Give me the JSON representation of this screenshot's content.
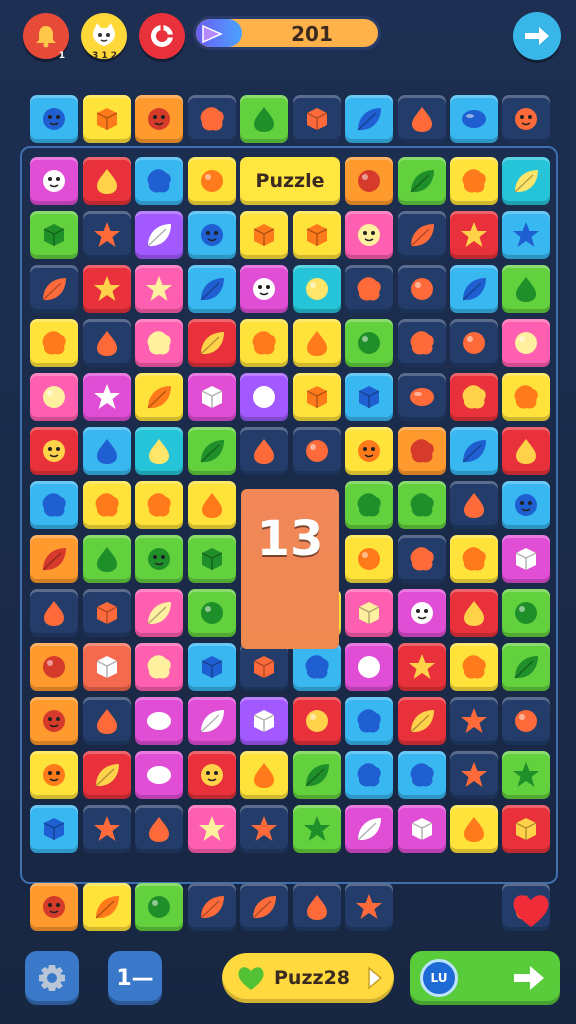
{
  "top_bar": {
    "progress_value": "201",
    "progress_fraction": 0.25,
    "bell_badge": "1",
    "cat_badge": "3 1 2",
    "buttons": [
      "bell-icon",
      "cat-face-icon",
      "lifesaver-icon",
      "arrow-right-icon"
    ]
  },
  "board": {
    "puzzle_label": "Puzzle",
    "big_number": "13"
  },
  "bottom_bar": {
    "left_icon": "gear-icon",
    "menu_label": "1—",
    "puzzle_button_label": "Puzz28",
    "go_coin_label": "LU"
  },
  "palette": {
    "yellow": "#ffe23a",
    "red": "#e8313a",
    "blue": "#39b7f0",
    "orange": "#ff9a2e",
    "green": "#63d13e",
    "pink": "#ff5fb0",
    "purple": "#a259ff",
    "teal": "#25c4d8",
    "magenta": "#e14ed6",
    "navy": "#233c6a",
    "salmon": "#f46a4e"
  },
  "tiles": [
    {
      "row": 0,
      "col": 0,
      "c": "blue",
      "s": "face"
    },
    {
      "row": 0,
      "col": 1,
      "c": "yellow",
      "s": "box"
    },
    {
      "row": 0,
      "col": 2,
      "c": "orange",
      "s": "face"
    },
    {
      "row": 0,
      "col": 3,
      "c": "navy",
      "s": "blob"
    },
    {
      "row": 0,
      "col": 4,
      "c": "green",
      "s": "drop"
    },
    {
      "row": 0,
      "col": 5,
      "c": "navy",
      "s": "box"
    },
    {
      "row": 0,
      "col": 6,
      "c": "blue",
      "s": "leaf"
    },
    {
      "row": 0,
      "col": 7,
      "c": "navy",
      "s": "drop"
    },
    {
      "row": 0,
      "col": 8,
      "c": "blue",
      "s": "oval"
    },
    {
      "row": 0,
      "col": 9,
      "c": "navy",
      "s": "face"
    },
    {
      "row": 1,
      "col": 0,
      "c": "magenta",
      "s": "face"
    },
    {
      "row": 1,
      "col": 1,
      "c": "red",
      "s": "drop"
    },
    {
      "row": 1,
      "col": 2,
      "c": "blue",
      "s": "blob"
    },
    {
      "row": 1,
      "col": 3,
      "c": "yellow",
      "s": "circle"
    },
    {
      "row": 1,
      "col": 6,
      "c": "orange",
      "s": "circle"
    },
    {
      "row": 1,
      "col": 7,
      "c": "green",
      "s": "leaf"
    },
    {
      "row": 1,
      "col": 8,
      "c": "yellow",
      "s": "blob"
    },
    {
      "row": 1,
      "col": 9,
      "c": "teal",
      "s": "leaf"
    },
    {
      "row": 2,
      "col": 0,
      "c": "green",
      "s": "box"
    },
    {
      "row": 2,
      "col": 1,
      "c": "navy",
      "s": "star"
    },
    {
      "row": 2,
      "col": 2,
      "c": "purple",
      "s": "leaf"
    },
    {
      "row": 2,
      "col": 3,
      "c": "blue",
      "s": "face"
    },
    {
      "row": 2,
      "col": 4,
      "c": "yellow",
      "s": "box"
    },
    {
      "row": 2,
      "col": 5,
      "c": "yellow",
      "s": "box"
    },
    {
      "row": 2,
      "col": 6,
      "c": "pink",
      "s": "face"
    },
    {
      "row": 2,
      "col": 7,
      "c": "navy",
      "s": "leaf"
    },
    {
      "row": 2,
      "col": 8,
      "c": "red",
      "s": "star"
    },
    {
      "row": 2,
      "col": 9,
      "c": "blue",
      "s": "star"
    },
    {
      "row": 3,
      "col": 0,
      "c": "navy",
      "s": "leaf"
    },
    {
      "row": 3,
      "col": 1,
      "c": "red",
      "s": "star"
    },
    {
      "row": 3,
      "col": 2,
      "c": "pink",
      "s": "star"
    },
    {
      "row": 3,
      "col": 3,
      "c": "blue",
      "s": "leaf"
    },
    {
      "row": 3,
      "col": 4,
      "c": "magenta",
      "s": "face"
    },
    {
      "row": 3,
      "col": 5,
      "c": "teal",
      "s": "circle"
    },
    {
      "row": 3,
      "col": 6,
      "c": "navy",
      "s": "blob"
    },
    {
      "row": 3,
      "col": 7,
      "c": "navy",
      "s": "circle"
    },
    {
      "row": 3,
      "col": 8,
      "c": "blue",
      "s": "leaf"
    },
    {
      "row": 3,
      "col": 9,
      "c": "green",
      "s": "drop"
    },
    {
      "row": 4,
      "col": 0,
      "c": "yellow",
      "s": "blob"
    },
    {
      "row": 4,
      "col": 1,
      "c": "navy",
      "s": "drop"
    },
    {
      "row": 4,
      "col": 2,
      "c": "pink",
      "s": "blob"
    },
    {
      "row": 4,
      "col": 3,
      "c": "red",
      "s": "leaf"
    },
    {
      "row": 4,
      "col": 4,
      "c": "yellow",
      "s": "blob"
    },
    {
      "row": 4,
      "col": 5,
      "c": "yellow",
      "s": "drop"
    },
    {
      "row": 4,
      "col": 6,
      "c": "green",
      "s": "circle"
    },
    {
      "row": 4,
      "col": 7,
      "c": "navy",
      "s": "blob"
    },
    {
      "row": 4,
      "col": 8,
      "c": "navy",
      "s": "circle"
    },
    {
      "row": 4,
      "col": 9,
      "c": "pink",
      "s": "circle"
    },
    {
      "row": 5,
      "col": 0,
      "c": "pink",
      "s": "circle"
    },
    {
      "row": 5,
      "col": 1,
      "c": "magenta",
      "s": "star"
    },
    {
      "row": 5,
      "col": 2,
      "c": "yellow",
      "s": "leaf"
    },
    {
      "row": 5,
      "col": 3,
      "c": "magenta",
      "s": "box"
    },
    {
      "row": 5,
      "col": 4,
      "c": "purple",
      "s": "circle"
    },
    {
      "row": 5,
      "col": 5,
      "c": "yellow",
      "s": "box"
    },
    {
      "row": 5,
      "col": 6,
      "c": "blue",
      "s": "box"
    },
    {
      "row": 5,
      "col": 7,
      "c": "navy",
      "s": "oval"
    },
    {
      "row": 5,
      "col": 8,
      "c": "red",
      "s": "blob"
    },
    {
      "row": 5,
      "col": 9,
      "c": "yellow",
      "s": "blob"
    },
    {
      "row": 6,
      "col": 0,
      "c": "red",
      "s": "face"
    },
    {
      "row": 6,
      "col": 1,
      "c": "blue",
      "s": "drop"
    },
    {
      "row": 6,
      "col": 2,
      "c": "teal",
      "s": "drop"
    },
    {
      "row": 6,
      "col": 3,
      "c": "green",
      "s": "leaf"
    },
    {
      "row": 6,
      "col": 4,
      "c": "navy",
      "s": "drop"
    },
    {
      "row": 6,
      "col": 5,
      "c": "navy",
      "s": "circle"
    },
    {
      "row": 6,
      "col": 6,
      "c": "yellow",
      "s": "face"
    },
    {
      "row": 6,
      "col": 7,
      "c": "orange",
      "s": "blob"
    },
    {
      "row": 6,
      "col": 8,
      "c": "blue",
      "s": "leaf"
    },
    {
      "row": 6,
      "col": 9,
      "c": "red",
      "s": "drop"
    },
    {
      "row": 7,
      "col": 0,
      "c": "blue",
      "s": "blob"
    },
    {
      "row": 7,
      "col": 1,
      "c": "yellow",
      "s": "blob"
    },
    {
      "row": 7,
      "col": 2,
      "c": "yellow",
      "s": "blob"
    },
    {
      "row": 7,
      "col": 3,
      "c": "yellow",
      "s": "drop"
    },
    {
      "row": 7,
      "col": 6,
      "c": "green",
      "s": "blob"
    },
    {
      "row": 7,
      "col": 7,
      "c": "green",
      "s": "blob"
    },
    {
      "row": 7,
      "col": 8,
      "c": "navy",
      "s": "drop"
    },
    {
      "row": 7,
      "col": 9,
      "c": "blue",
      "s": "face"
    },
    {
      "row": 8,
      "col": 0,
      "c": "orange",
      "s": "leaf"
    },
    {
      "row": 8,
      "col": 1,
      "c": "green",
      "s": "drop"
    },
    {
      "row": 8,
      "col": 2,
      "c": "green",
      "s": "face"
    },
    {
      "row": 8,
      "col": 3,
      "c": "green",
      "s": "box"
    },
    {
      "row": 8,
      "col": 6,
      "c": "yellow",
      "s": "circle"
    },
    {
      "row": 8,
      "col": 7,
      "c": "navy",
      "s": "blob"
    },
    {
      "row": 8,
      "col": 8,
      "c": "yellow",
      "s": "blob"
    },
    {
      "row": 8,
      "col": 9,
      "c": "magenta",
      "s": "box"
    },
    {
      "row": 9,
      "col": 0,
      "c": "navy",
      "s": "drop"
    },
    {
      "row": 9,
      "col": 1,
      "c": "navy",
      "s": "box"
    },
    {
      "row": 9,
      "col": 2,
      "c": "pink",
      "s": "leaf"
    },
    {
      "row": 9,
      "col": 3,
      "c": "green",
      "s": "circle"
    },
    {
      "row": 9,
      "col": 5,
      "c": "yellow",
      "s": "circle"
    },
    {
      "row": 9,
      "col": 6,
      "c": "pink",
      "s": "box"
    },
    {
      "row": 9,
      "col": 7,
      "c": "magenta",
      "s": "face"
    },
    {
      "row": 9,
      "col": 8,
      "c": "red",
      "s": "drop"
    },
    {
      "row": 9,
      "col": 9,
      "c": "green",
      "s": "circle"
    },
    {
      "row": 10,
      "col": 0,
      "c": "orange",
      "s": "circle"
    },
    {
      "row": 10,
      "col": 1,
      "c": "salmon",
      "s": "box"
    },
    {
      "row": 10,
      "col": 2,
      "c": "pink",
      "s": "blob"
    },
    {
      "row": 10,
      "col": 3,
      "c": "blue",
      "s": "box"
    },
    {
      "row": 10,
      "col": 4,
      "c": "navy",
      "s": "box"
    },
    {
      "row": 10,
      "col": 5,
      "c": "blue",
      "s": "blob"
    },
    {
      "row": 10,
      "col": 6,
      "c": "magenta",
      "s": "circle"
    },
    {
      "row": 10,
      "col": 7,
      "c": "red",
      "s": "star"
    },
    {
      "row": 10,
      "col": 8,
      "c": "yellow",
      "s": "blob"
    },
    {
      "row": 10,
      "col": 9,
      "c": "green",
      "s": "leaf"
    },
    {
      "row": 11,
      "col": 0,
      "c": "orange",
      "s": "face"
    },
    {
      "row": 11,
      "col": 1,
      "c": "navy",
      "s": "drop"
    },
    {
      "row": 11,
      "col": 2,
      "c": "magenta",
      "s": "oval"
    },
    {
      "row": 11,
      "col": 3,
      "c": "magenta",
      "s": "leaf"
    },
    {
      "row": 11,
      "col": 4,
      "c": "purple",
      "s": "box"
    },
    {
      "row": 11,
      "col": 5,
      "c": "red",
      "s": "circle"
    },
    {
      "row": 11,
      "col": 6,
      "c": "blue",
      "s": "blob"
    },
    {
      "row": 11,
      "col": 7,
      "c": "red",
      "s": "leaf"
    },
    {
      "row": 11,
      "col": 8,
      "c": "navy",
      "s": "star"
    },
    {
      "row": 11,
      "col": 9,
      "c": "navy",
      "s": "circle"
    },
    {
      "row": 12,
      "col": 0,
      "c": "yellow",
      "s": "face"
    },
    {
      "row": 12,
      "col": 1,
      "c": "red",
      "s": "leaf"
    },
    {
      "row": 12,
      "col": 2,
      "c": "magenta",
      "s": "oval"
    },
    {
      "row": 12,
      "col": 3,
      "c": "red",
      "s": "face"
    },
    {
      "row": 12,
      "col": 4,
      "c": "yellow",
      "s": "drop"
    },
    {
      "row": 12,
      "col": 5,
      "c": "green",
      "s": "leaf"
    },
    {
      "row": 12,
      "col": 6,
      "c": "blue",
      "s": "blob"
    },
    {
      "row": 12,
      "col": 7,
      "c": "blue",
      "s": "blob"
    },
    {
      "row": 12,
      "col": 8,
      "c": "navy",
      "s": "star"
    },
    {
      "row": 12,
      "col": 9,
      "c": "green",
      "s": "star"
    },
    {
      "row": 13,
      "col": 0,
      "c": "blue",
      "s": "box"
    },
    {
      "row": 13,
      "col": 1,
      "c": "navy",
      "s": "star"
    },
    {
      "row": 13,
      "col": 2,
      "c": "navy",
      "s": "drop"
    },
    {
      "row": 13,
      "col": 3,
      "c": "pink",
      "s": "star"
    },
    {
      "row": 13,
      "col": 4,
      "c": "navy",
      "s": "star"
    },
    {
      "row": 13,
      "col": 5,
      "c": "green",
      "s": "star"
    },
    {
      "row": 13,
      "col": 6,
      "c": "magenta",
      "s": "leaf"
    },
    {
      "row": 13,
      "col": 7,
      "c": "magenta",
      "s": "box"
    },
    {
      "row": 13,
      "col": 8,
      "c": "yellow",
      "s": "drop"
    },
    {
      "row": 13,
      "col": 9,
      "c": "red",
      "s": "box"
    },
    {
      "row": 14,
      "col": 0,
      "c": "orange",
      "s": "face"
    },
    {
      "row": 14,
      "col": 1,
      "c": "yellow",
      "s": "leaf"
    },
    {
      "row": 14,
      "col": 2,
      "c": "green",
      "s": "circle"
    },
    {
      "row": 14,
      "col": 3,
      "c": "navy",
      "s": "leaf"
    },
    {
      "row": 14,
      "col": 4,
      "c": "navy",
      "s": "leaf"
    },
    {
      "row": 14,
      "col": 5,
      "c": "navy",
      "s": "drop"
    },
    {
      "row": 14,
      "col": 6,
      "c": "navy",
      "s": "star"
    },
    {
      "row": 14,
      "col": 9,
      "c": "navy",
      "s": "drop"
    }
  ]
}
